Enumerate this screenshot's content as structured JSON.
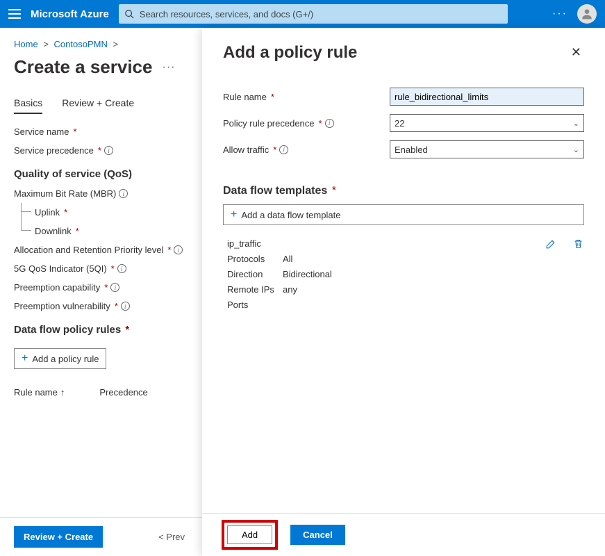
{
  "topbar": {
    "brand": "Microsoft Azure",
    "search_placeholder": "Search resources, services, and docs (G+/)"
  },
  "breadcrumb": {
    "home": "Home",
    "item": "ContosoPMN"
  },
  "pageTitle": "Create a service",
  "tabs": {
    "basics": "Basics",
    "review": "Review + Create"
  },
  "fields": {
    "service_name": "Service name",
    "service_precedence": "Service precedence",
    "qos_heading": "Quality of service (QoS)",
    "mbr": "Maximum Bit Rate (MBR)",
    "uplink": "Uplink",
    "downlink": "Downlink",
    "arp": "Allocation and Retention Priority level",
    "fiveqi": "5G QoS Indicator (5QI)",
    "preempt_cap": "Preemption capability",
    "preempt_vul": "Preemption vulnerability",
    "rules_heading": "Data flow policy rules",
    "add_rule": "Add a policy rule",
    "col_rule_name": "Rule name",
    "col_precedence": "Precedence"
  },
  "footer": {
    "review_create": "Review + Create",
    "previous": "< Prev"
  },
  "panel": {
    "title": "Add a policy rule",
    "rule_name_label": "Rule name",
    "rule_name_value": "rule_bidirectional_limits",
    "precedence_label": "Policy rule precedence",
    "precedence_value": "22",
    "allow_label": "Allow traffic",
    "allow_value": "Enabled",
    "templates_heading": "Data flow templates",
    "add_template": "Add a data flow template",
    "template": {
      "name": "ip_traffic",
      "protocols_k": "Protocols",
      "protocols_v": "All",
      "direction_k": "Direction",
      "direction_v": "Bidirectional",
      "remote_k": "Remote IPs",
      "remote_v": "any",
      "ports_k": "Ports",
      "ports_v": ""
    },
    "add_btn": "Add",
    "cancel_btn": "Cancel"
  }
}
